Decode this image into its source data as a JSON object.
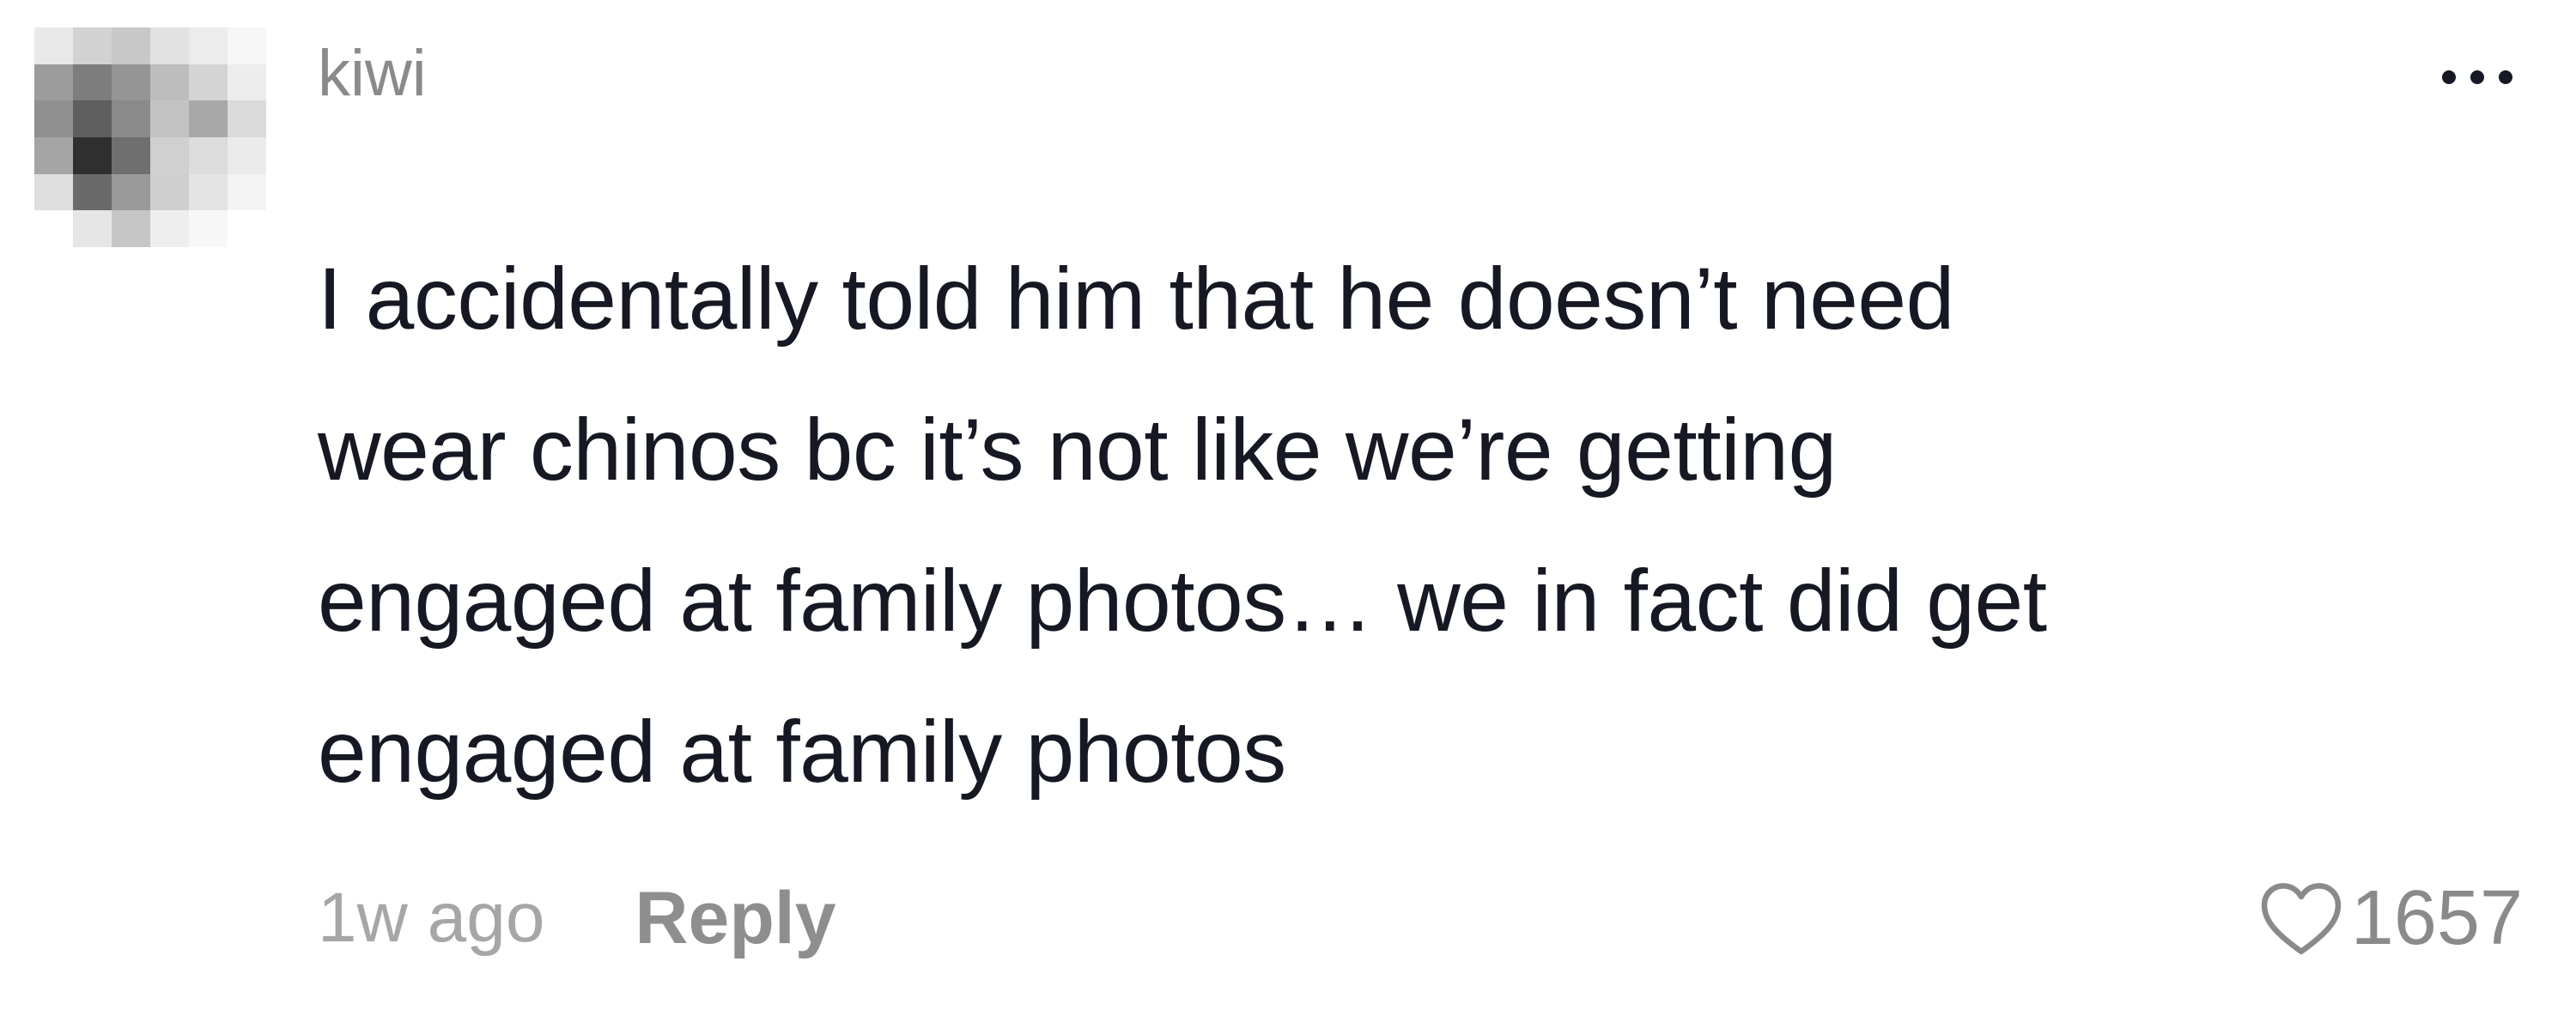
{
  "comment": {
    "username": "kiwi",
    "text": "I accidentally told him that he doesn’t need\nwear chinos bc it’s not like we’re getting\nengaged at family photos… we in fact did get\nengaged at family photos",
    "timestamp": "1w ago",
    "reply_label": "Reply",
    "like_count": "1657",
    "icons": {
      "more": "more-horizontal-icon",
      "like": "heart-outline-icon"
    },
    "colors": {
      "text": "#161823",
      "username": "#8a8a8a",
      "meta": "#a6a6a6"
    }
  }
}
